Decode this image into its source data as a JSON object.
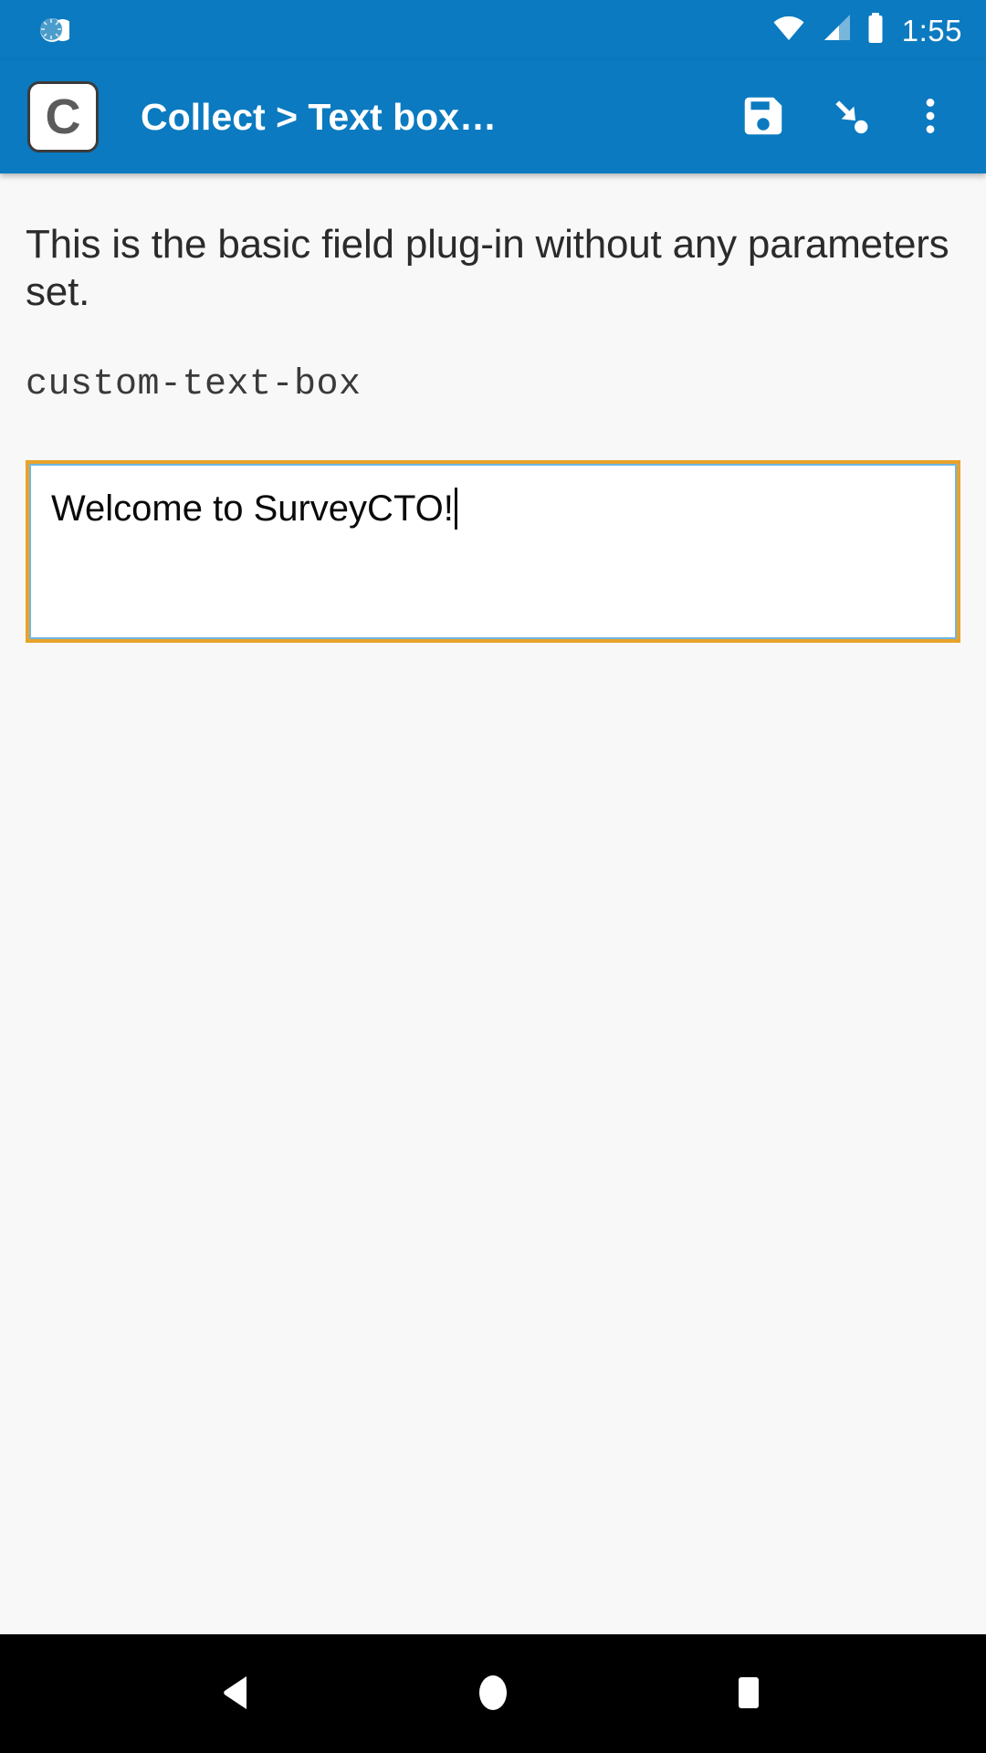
{
  "status_bar": {
    "left_icon": "sync-circle-icon",
    "wifi_icon": "wifi-icon",
    "signal_icon": "cellular-signal-icon",
    "battery_icon": "battery-icon",
    "time": "1:55"
  },
  "app_bar": {
    "logo_letter": "C",
    "logo_name": "collect-app-logo",
    "title": "Collect > Text box…",
    "actions": [
      {
        "name": "save-form-button",
        "icon": "save-floppy-icon"
      },
      {
        "name": "goto-prompt-button",
        "icon": "arrow-to-dot-icon"
      },
      {
        "name": "overflow-menu-button",
        "icon": "more-vert-icon"
      }
    ]
  },
  "form": {
    "question_text": "This is the basic field plug-in without any parameters set.",
    "field_name": "custom-text-box",
    "answer_value": "Welcome to SurveyCTO!",
    "answer_placeholder": ""
  },
  "nav_bar": {
    "back": "back-triangle-icon",
    "home": "home-circle-icon",
    "recents": "recents-square-icon"
  },
  "colors": {
    "app_bar_blue": "#0B7AC0",
    "content_bg": "#F8F8F8",
    "input_border_outer": "#E9A22B",
    "input_border_inner": "#6FB7E0",
    "nav_bar": "#000000",
    "text_primary": "#2B2B2B"
  }
}
